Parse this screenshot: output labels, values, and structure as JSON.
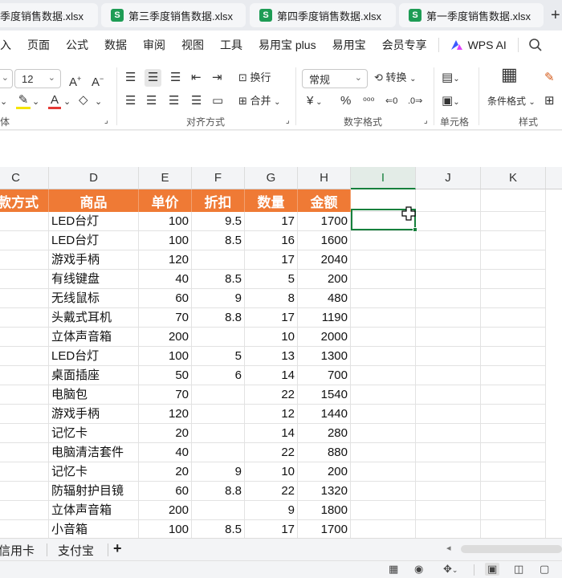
{
  "tabs": [
    {
      "label": "季度销售数据.xlsx",
      "icon": "S"
    },
    {
      "label": "第三季度销售数据.xlsx",
      "icon": "S"
    },
    {
      "label": "第四季度销售数据.xlsx",
      "icon": "S"
    },
    {
      "label": "第一季度销售数据.xlsx",
      "icon": "S"
    }
  ],
  "tab_add": "+",
  "menu": {
    "items": [
      "入",
      "页面",
      "公式",
      "数据",
      "审阅",
      "视图",
      "工具",
      "易用宝 plus",
      "易用宝",
      "会员专享"
    ],
    "wps_ai": "WPS AI"
  },
  "ribbon": {
    "font_size": "12",
    "number_format": "常规",
    "wrap_text": "换行",
    "convert": "转换",
    "merge": "合并",
    "conditional_format": "条件格式",
    "group_font": "体",
    "group_align": "对齐方式",
    "group_number": "数字格式",
    "group_cell": "单元格",
    "group_style": "样式"
  },
  "grid": {
    "columns": [
      "C",
      "D",
      "E",
      "F",
      "G",
      "H",
      "I",
      "J",
      "K"
    ],
    "active_column": "I",
    "headers": [
      "款方式",
      "商品",
      "单价",
      "折扣",
      "数量",
      "金额"
    ],
    "rows": [
      {
        "product": "LED台灯",
        "price": "100",
        "discount": "9.5",
        "qty": "17",
        "amount": "1700"
      },
      {
        "product": "LED台灯",
        "price": "100",
        "discount": "8.5",
        "qty": "16",
        "amount": "1600"
      },
      {
        "product": "游戏手柄",
        "price": "120",
        "discount": "",
        "qty": "17",
        "amount": "2040"
      },
      {
        "product": "有线键盘",
        "price": "40",
        "discount": "8.5",
        "qty": "5",
        "amount": "200"
      },
      {
        "product": "无线鼠标",
        "price": "60",
        "discount": "9",
        "qty": "8",
        "amount": "480"
      },
      {
        "product": "头戴式耳机",
        "price": "70",
        "discount": "8.8",
        "qty": "17",
        "amount": "1190"
      },
      {
        "product": "立体声音箱",
        "price": "200",
        "discount": "",
        "qty": "10",
        "amount": "2000"
      },
      {
        "product": "LED台灯",
        "price": "100",
        "discount": "5",
        "qty": "13",
        "amount": "1300"
      },
      {
        "product": "桌面插座",
        "price": "50",
        "discount": "6",
        "qty": "14",
        "amount": "700"
      },
      {
        "product": "电脑包",
        "price": "70",
        "discount": "",
        "qty": "22",
        "amount": "1540"
      },
      {
        "product": "游戏手柄",
        "price": "120",
        "discount": "",
        "qty": "12",
        "amount": "1440"
      },
      {
        "product": "记忆卡",
        "price": "20",
        "discount": "",
        "qty": "14",
        "amount": "280"
      },
      {
        "product": "电脑清洁套件",
        "price": "40",
        "discount": "",
        "qty": "22",
        "amount": "880"
      },
      {
        "product": "记忆卡",
        "price": "20",
        "discount": "9",
        "qty": "10",
        "amount": "200"
      },
      {
        "product": "防辐射护目镜",
        "price": "60",
        "discount": "8.8",
        "qty": "22",
        "amount": "1320"
      },
      {
        "product": "立体声音箱",
        "price": "200",
        "discount": "",
        "qty": "9",
        "amount": "1800"
      },
      {
        "product": "小音箱",
        "price": "100",
        "discount": "8.5",
        "qty": "17",
        "amount": "1700"
      }
    ]
  },
  "sheets": {
    "items": [
      "信用卡",
      "支付宝"
    ],
    "add": "+"
  },
  "colors": {
    "header_fill": "#ef7a35",
    "accent_green": "#16803c",
    "sheet_icon": "#1e9c55"
  }
}
